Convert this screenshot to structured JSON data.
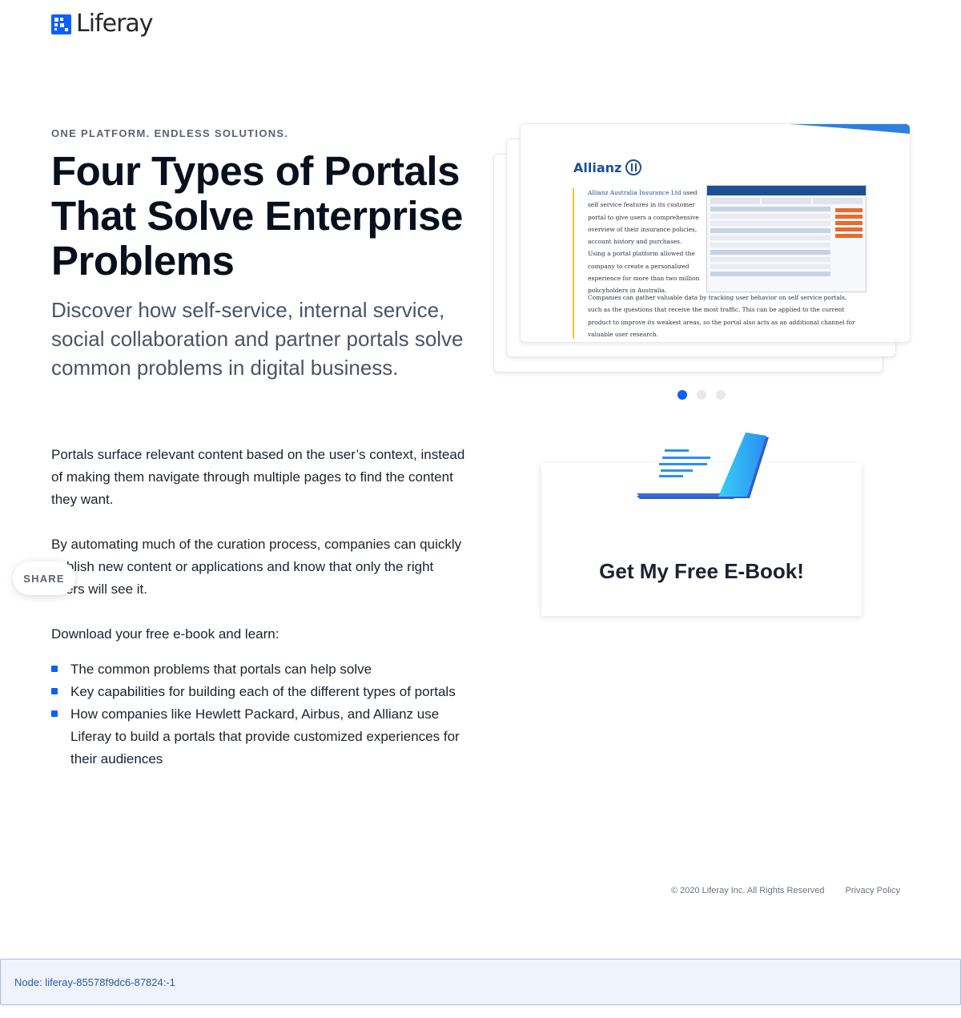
{
  "brand": {
    "logo_text": "Liferay",
    "accent_color": "#0b5fff"
  },
  "hero": {
    "eyebrow": "ONE PLATFORM. ENDLESS SOLUTIONS.",
    "headline": "Four Types of Portals That Solve Enterprise Problems",
    "subhead": "Discover how self-service, internal service, social collaboration and partner portals solve common problems in digital business."
  },
  "body": {
    "p1": "Portals surface relevant content based on the user’s context, instead of making them navigate through multiple pages to find the content they want.",
    "p2": "By automating much of the curation process, companies can quickly publish new content or applications and know that only the right users will see it.",
    "p3": "Download your free e-book and learn:",
    "bullets": [
      "The common problems that portals can help solve",
      "Key capabilities for building each of the different types of portals",
      "How companies like Hewlett Packard, Airbus, and Allianz use Liferay to build a portals that provide customized experiences for their audiences"
    ]
  },
  "share": {
    "label": "SHARE"
  },
  "carousel": {
    "slide": {
      "company_logo": "Allianz",
      "quote_link": "Allianz Australia Insurance Ltd",
      "quote_rest": " used self service features in its customer portal to give users a comprehensive overview of their insurance policies, account history and purchases. Using a portal platform allowed the company to create a personalized experience for more than two million policyholders in Australia.",
      "quote_2": "Companies can gather valuable data by tracking user behavior on self service portals, such as the questions that receive the most traffic. This can be applied to the current product to improve its weakest areas, so the portal also acts as an additional channel for valuable user research."
    },
    "active_index": 0,
    "slide_count": 3
  },
  "ebook": {
    "cta": "Get My Free E-Book!"
  },
  "footer": {
    "copyright": "© 2020 Liferay Inc. All Rights Reserved",
    "privacy": "Privacy Policy"
  },
  "node": {
    "text": "Node: liferay-85578f9dc6-87824:-1"
  }
}
